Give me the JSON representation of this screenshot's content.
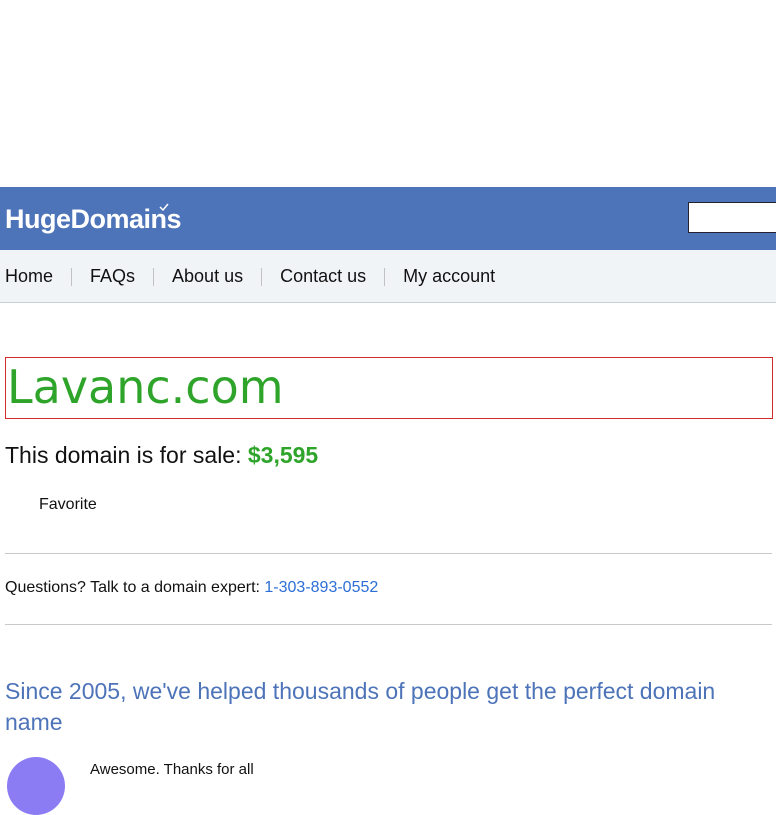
{
  "header": {
    "logo_text": "HugeDomains",
    "search": {
      "value": "",
      "placeholder": ""
    },
    "bg_color": "#4d73b8"
  },
  "nav": {
    "items": [
      {
        "label": "Home"
      },
      {
        "label": "FAQs"
      },
      {
        "label": "About us"
      },
      {
        "label": "Contact us"
      },
      {
        "label": "My account"
      }
    ]
  },
  "main": {
    "domain_name": "Lavanc.com",
    "sale_text": "This domain is for sale: ",
    "price": "$3,595",
    "favorite_label": "Favorite",
    "questions_text": "Questions? Talk to a domain expert: ",
    "phone": "1-303-893-0552",
    "tagline": "Since 2005, we've helped thousands of people get the perfect domain name",
    "testimonial_snippet": "Awesome. Thanks for all"
  },
  "colors": {
    "brand_blue": "#4d73b8",
    "price_green": "#2ea52a",
    "link_blue": "#2c6ed5",
    "highlight_red": "#d32b2b"
  }
}
